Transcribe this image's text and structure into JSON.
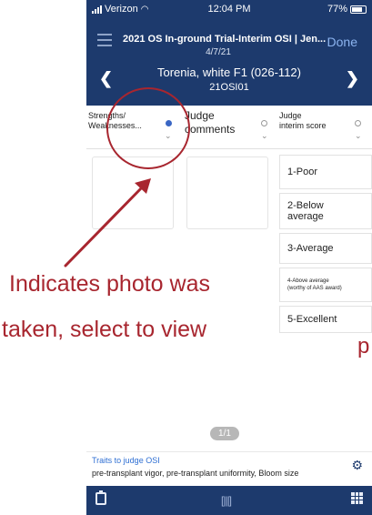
{
  "status_bar": {
    "carrier": "Verizon",
    "time": "12:04 PM",
    "battery": "77%"
  },
  "header": {
    "title": "2021 OS In-ground Trial-Interim OSI | Jen...",
    "date": "4/7/21",
    "done_label": "Done",
    "prev_icon": "chevron-left-icon",
    "next_icon": "chevron-right-icon",
    "menu_icon": "hamburger-icon"
  },
  "plot": {
    "name": "Torenia, white F1 (026-112)",
    "code": "21OSI01"
  },
  "tabs": [
    {
      "label": "Strengths/\nWeaknesses...",
      "selected": true
    },
    {
      "label": "Judge\ncomments",
      "selected": false
    },
    {
      "label": "Judge\ninterim score",
      "selected": false
    }
  ],
  "scores": [
    "1-Poor",
    "2-Below\naverage",
    "3-Average",
    "4-Above average\n(worthy of AAS award)",
    "5-Excellent"
  ],
  "pager": "1/1",
  "traits": {
    "title": "Traits to judge OSI",
    "text": "pre-transplant vigor, pre-transplant uniformity, Bloom size"
  },
  "tabbar": {
    "left_icon": "clipboard-icon",
    "center_icon": "barcode-scan-icon",
    "right_icon": "grid-icon"
  },
  "annotation": {
    "line1": "Indicates photo was",
    "line2": "taken, select to view",
    "trailing": "p",
    "color": "#a8262f"
  },
  "colors": {
    "navy": "#1d3a6d",
    "link_blue": "#2f6fd3",
    "selected_radio": "#3a66c4"
  }
}
